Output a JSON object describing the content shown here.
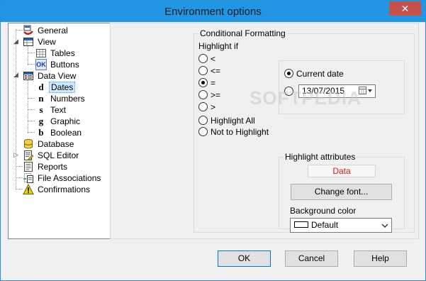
{
  "window": {
    "title": "Environment options",
    "close_glyph": "✕"
  },
  "tree": {
    "items": [
      {
        "label": "General",
        "icon": "general-icon"
      },
      {
        "label": "View",
        "icon": "view-icon"
      },
      {
        "label": "Tables",
        "icon": "tables-icon"
      },
      {
        "label": "Buttons",
        "icon": "buttons-icon",
        "glyph": "OK"
      },
      {
        "label": "Data View",
        "icon": "data-view-icon"
      },
      {
        "label": "Dates",
        "icon": "dates-icon",
        "glyph": "d",
        "selected": true
      },
      {
        "label": "Numbers",
        "icon": "numbers-icon",
        "glyph": "n"
      },
      {
        "label": "Text",
        "icon": "text-icon",
        "glyph": "s"
      },
      {
        "label": "Graphic",
        "icon": "graphic-icon",
        "glyph": "g"
      },
      {
        "label": "Boolean",
        "icon": "boolean-icon",
        "glyph": "b"
      },
      {
        "label": "Database",
        "icon": "database-icon"
      },
      {
        "label": "SQL Editor",
        "icon": "sql-editor-icon"
      },
      {
        "label": "Reports",
        "icon": "reports-icon"
      },
      {
        "label": "File Associations",
        "icon": "file-associations-icon"
      },
      {
        "label": "Confirmations",
        "icon": "confirmations-icon"
      }
    ]
  },
  "conditional": {
    "legend": "Conditional Formatting",
    "highlight_if_label": "Highlight if",
    "operators": [
      "<",
      "<=",
      "=",
      ">=",
      ">"
    ],
    "selected_operator": "=",
    "highlight_all": "Highlight All",
    "not_to_highlight": "Not to Highlight",
    "current_date_label": "Current date",
    "date_value": "13/07/2015"
  },
  "attributes": {
    "legend": "Highlight attributes",
    "sample_text": "Data",
    "change_font_label": "Change font...",
    "background_label": "Background color",
    "background_value": "Default"
  },
  "footer": {
    "ok_label": "OK",
    "cancel_label": "Cancel",
    "help_label": "Help"
  },
  "watermark": "SOFTPEDIA",
  "colors": {
    "titlebar": "#2196e4",
    "close": "#c7504a",
    "sample_text": "#d91515",
    "selection": "#cde8ff"
  }
}
